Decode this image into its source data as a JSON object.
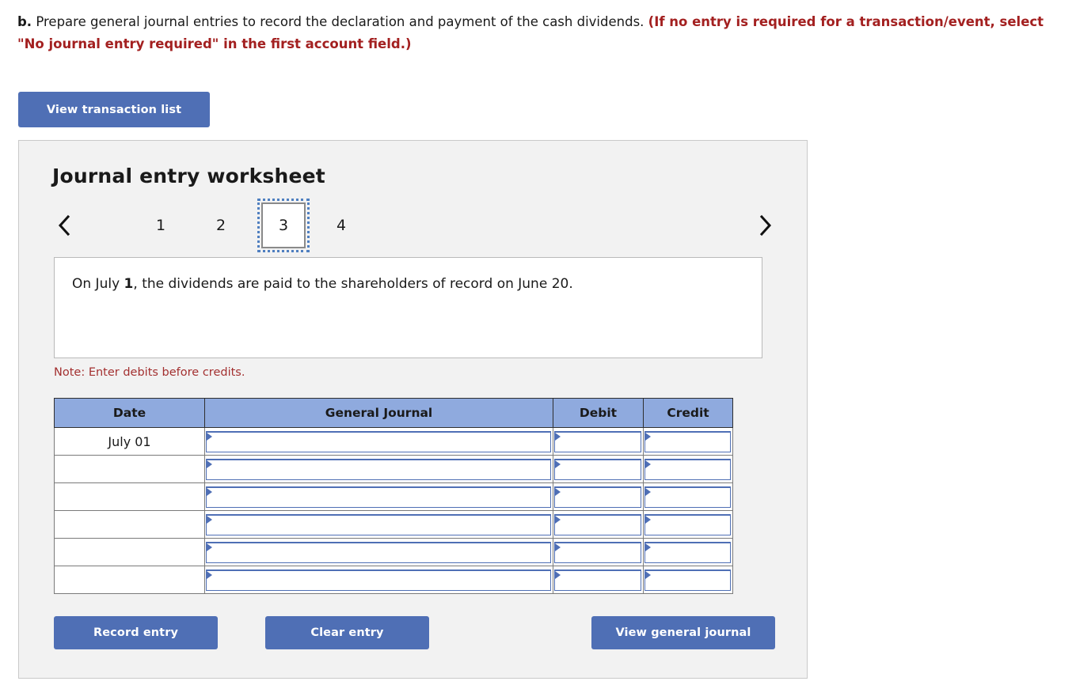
{
  "prompt": {
    "lead": "b.",
    "body": " Prepare general journal entries to record the declaration and payment of the cash dividends. ",
    "hint": "(If no entry is required for a transaction/event, select \"No journal entry required\" in the first account field.)"
  },
  "toolbar": {
    "view_transaction_list": "View transaction list"
  },
  "worksheet": {
    "title": "Journal entry worksheet",
    "tabs": [
      "1",
      "2",
      "3",
      "4"
    ],
    "active_tab": "3",
    "prev_icon": "chevron-left-icon",
    "next_icon": "chevron-right-icon",
    "transaction": {
      "prefix": "On July ",
      "emphasis": "1",
      "suffix": ", the dividends are paid to the shareholders of record on June 20."
    },
    "note": "Note: Enter debits before credits.",
    "table": {
      "headers": [
        "Date",
        "General Journal",
        "Debit",
        "Credit"
      ],
      "rows": [
        {
          "date": "July 01"
        },
        {
          "date": ""
        },
        {
          "date": ""
        },
        {
          "date": ""
        },
        {
          "date": ""
        },
        {
          "date": ""
        }
      ]
    },
    "actions": {
      "record_entry": "Record entry",
      "clear_entry": "Clear entry",
      "view_general_journal": "View general journal"
    }
  },
  "colors": {
    "button_blue": "#4f6fb5",
    "header_blue": "#8faade",
    "panel_gray": "#f2f2f2",
    "note_red": "#a33030",
    "hint_red": "#a32020"
  }
}
